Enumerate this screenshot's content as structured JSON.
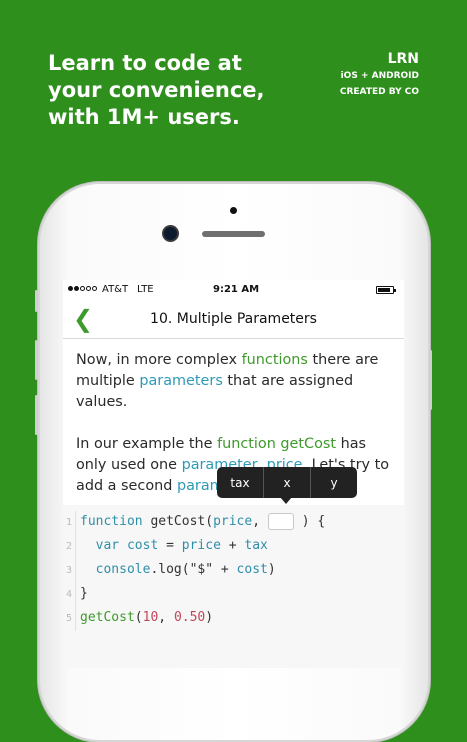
{
  "promo": {
    "headline": [
      "Learn to code at",
      "your convenience,",
      "with 1M+ users."
    ],
    "brand": "LRN",
    "platforms": "iOS + ANDROID",
    "credit": "CREATED BY CO"
  },
  "statusbar": {
    "signal_dots_filled": 2,
    "signal_dots_total": 5,
    "carrier": "AT&T",
    "network": "LTE",
    "time": "9:21 AM",
    "battery_level": 0.85
  },
  "nav": {
    "back_icon": "chevron-left-icon",
    "title": "10. Multiple Parameters"
  },
  "lesson": {
    "p1": [
      {
        "t": "Now, in more complex ",
        "c": ""
      },
      {
        "t": "functions",
        "c": "green"
      },
      {
        "t": " there are multiple ",
        "c": ""
      },
      {
        "t": "parameters",
        "c": "blue"
      },
      {
        "t": " that are assigned values.",
        "c": ""
      }
    ],
    "p2": [
      {
        "t": "In our example the ",
        "c": ""
      },
      {
        "t": "function getCost",
        "c": "green"
      },
      {
        "t": " has only used one ",
        "c": ""
      },
      {
        "t": "parameter, price",
        "c": "blue"
      },
      {
        "t": ". Let's try to add a second ",
        "c": ""
      },
      {
        "t": "param",
        "c": "blue"
      }
    ]
  },
  "code": {
    "lines": [
      {
        "n": "1",
        "tokens": [
          {
            "t": "function ",
            "c": "kw"
          },
          {
            "t": "getCost(",
            "c": "tx"
          },
          {
            "t": "price",
            "c": "pm"
          },
          {
            "t": ", ",
            "c": "tx"
          },
          {
            "t": "",
            "c": "blank"
          },
          {
            "t": " ) {",
            "c": "tx"
          }
        ]
      },
      {
        "n": "2",
        "tokens": [
          {
            "t": "  var ",
            "c": "kw"
          },
          {
            "t": "cost ",
            "c": "pm"
          },
          {
            "t": "= ",
            "c": "tx"
          },
          {
            "t": "price ",
            "c": "pm"
          },
          {
            "t": "+ ",
            "c": "tx"
          },
          {
            "t": "tax",
            "c": "pm"
          }
        ]
      },
      {
        "n": "3",
        "tokens": [
          {
            "t": "  console",
            "c": "kw"
          },
          {
            "t": ".log(\"$\" + ",
            "c": "tx"
          },
          {
            "t": "cost",
            "c": "pm"
          },
          {
            "t": ")",
            "c": "tx"
          }
        ]
      },
      {
        "n": "4",
        "tokens": [
          {
            "t": "}",
            "c": "tx"
          }
        ]
      },
      {
        "n": "5",
        "tokens": [
          {
            "t": "getCost",
            "c": "gr"
          },
          {
            "t": "(",
            "c": "tx"
          },
          {
            "t": "10",
            "c": "num"
          },
          {
            "t": ", ",
            "c": "tx"
          },
          {
            "t": "0.50",
            "c": "num"
          },
          {
            "t": ")",
            "c": "tx"
          }
        ]
      }
    ]
  },
  "popover": {
    "options": [
      "tax",
      "x",
      "y"
    ]
  },
  "colors": {
    "background": "#2f8f1c",
    "accent_green": "#3e9a2c",
    "accent_blue": "#2f9ab5",
    "number": "#c0475a"
  }
}
